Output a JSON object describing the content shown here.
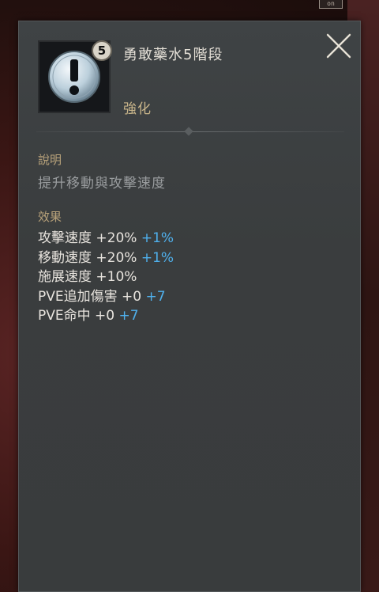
{
  "corner_tag": "on",
  "item": {
    "title": "勇敢藥水5階段",
    "category": "強化",
    "stack_badge": "5",
    "icon": "exclamation-icon"
  },
  "description": {
    "label": "說明",
    "text": "提升移動與攻擊速度"
  },
  "effects": {
    "label": "效果",
    "lines": [
      {
        "text": "攻擊速度 +20%",
        "bonus": "+1%"
      },
      {
        "text": "移動速度 +20%",
        "bonus": "+1%"
      },
      {
        "text": "施展速度 +10%",
        "bonus": ""
      },
      {
        "text": "PVE追加傷害 +0",
        "bonus": "+7"
      },
      {
        "text": "PVE命中 +0",
        "bonus": "+7"
      }
    ]
  },
  "colors": {
    "panel": "#3c3f41",
    "section_label": "#b8a27a",
    "bonus": "#4fb0ec",
    "category": "#c9b58a"
  }
}
